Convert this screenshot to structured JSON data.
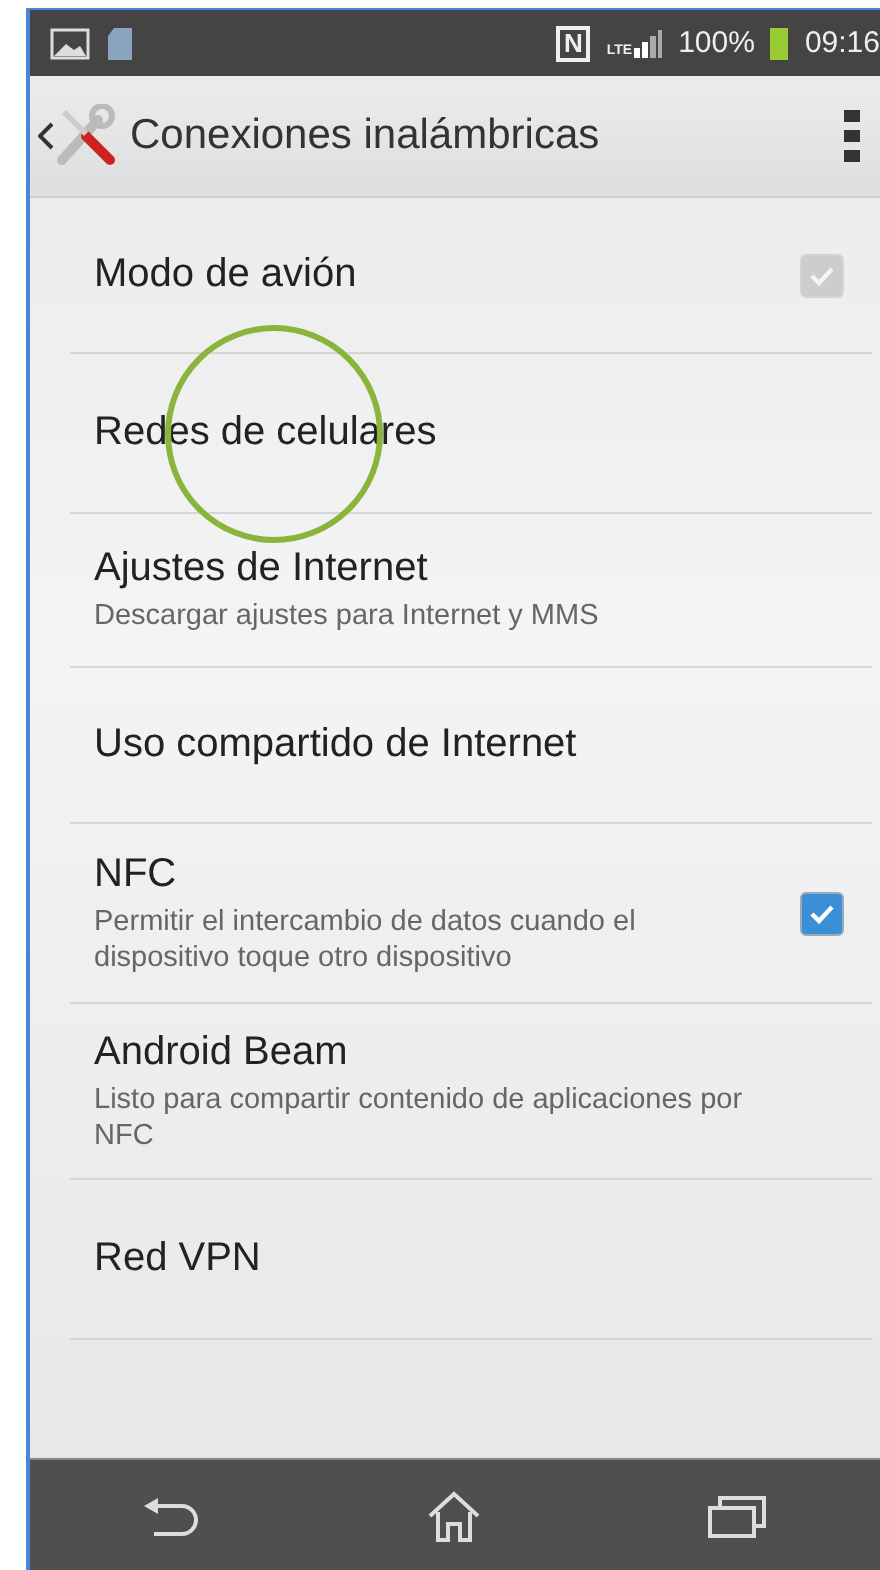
{
  "status_bar": {
    "nfc": "N",
    "network": "LTE",
    "battery": "100%",
    "time": "09:16"
  },
  "action_bar": {
    "title": "Conexiones inalámbricas"
  },
  "items": [
    {
      "kind": "check",
      "title": "Modo de avión",
      "checked": true,
      "disabled": true
    },
    {
      "kind": "plain",
      "title": "Redes de celulares"
    },
    {
      "kind": "plain",
      "title": "Ajustes de Internet",
      "summary": "Descargar ajustes para Internet y MMS"
    },
    {
      "kind": "plain",
      "title": "Uso compartido de Internet"
    },
    {
      "kind": "check",
      "title": "NFC",
      "summary": "Permitir el intercambio de datos cuando el dispositivo toque otro dispositivo",
      "checked": true,
      "disabled": false
    },
    {
      "kind": "plain",
      "title": "Android Beam",
      "summary": "Listo para compartir contenido de aplicaciones por NFC"
    },
    {
      "kind": "plain",
      "title": "Red VPN"
    }
  ]
}
